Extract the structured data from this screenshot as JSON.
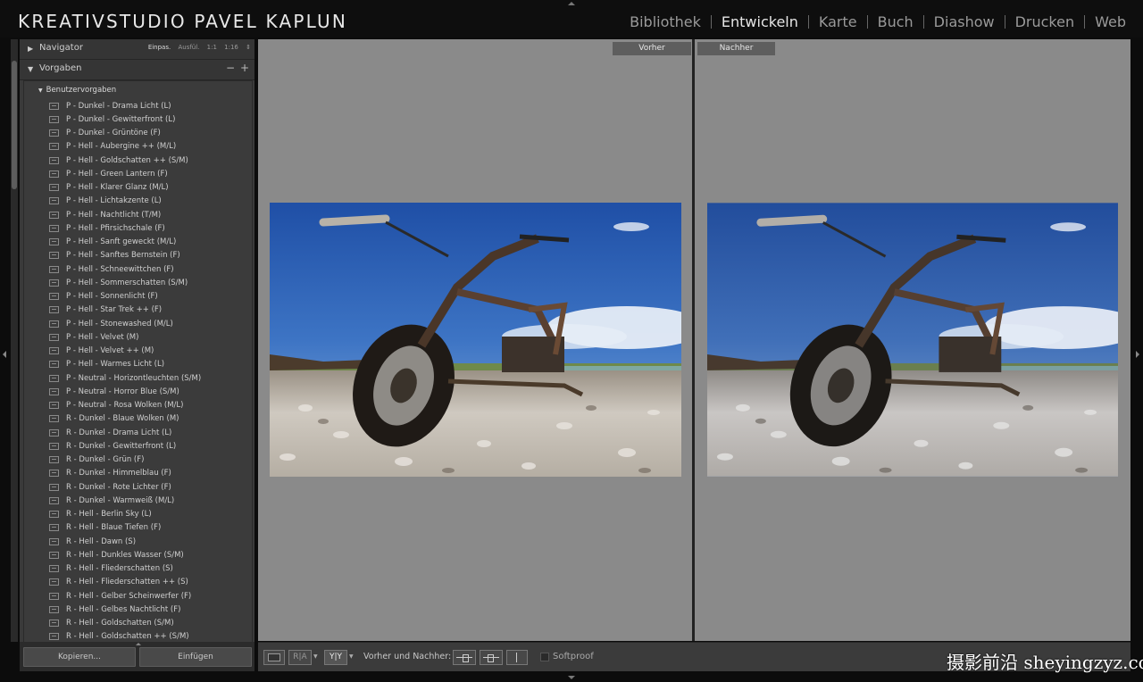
{
  "app": {
    "studio_name": "KREATIVSTUDIO PAVEL KAPLUN"
  },
  "modules": [
    {
      "label": "Bibliothek",
      "active": false
    },
    {
      "label": "Entwickeln",
      "active": true
    },
    {
      "label": "Karte",
      "active": false
    },
    {
      "label": "Buch",
      "active": false
    },
    {
      "label": "Diashow",
      "active": false
    },
    {
      "label": "Drucken",
      "active": false
    },
    {
      "label": "Web",
      "active": false
    }
  ],
  "left_panel": {
    "navigator": {
      "label": "Navigator",
      "options": [
        "Einpas.",
        "Ausfül.",
        "1:1",
        "1:16"
      ]
    },
    "presets": {
      "label": "Vorgaben",
      "minus": "−",
      "plus": "+",
      "folder": "Benutzervorgaben",
      "items": [
        "P - Dunkel - Drama Licht (L)",
        "P - Dunkel - Gewitterfront (L)",
        "P - Dunkel - Grüntöne (F)",
        "P - Hell - Aubergine ++ (M/L)",
        "P - Hell - Goldschatten ++ (S/M)",
        "P - Hell - Green Lantern (F)",
        "P - Hell - Klarer Glanz (M/L)",
        "P - Hell - Lichtakzente (L)",
        "P - Hell - Nachtlicht (T/M)",
        "P - Hell - Pfirsichschale (F)",
        "P - Hell - Sanft geweckt (M/L)",
        "P - Hell - Sanftes Bernstein (F)",
        "P - Hell - Schneewittchen (F)",
        "P - Hell - Sommerschatten (S/M)",
        "P - Hell - Sonnenlicht (F)",
        "P - Hell - Star Trek ++ (F)",
        "P - Hell - Stonewashed (M/L)",
        "P - Hell - Velvet (M)",
        "P - Hell - Velvet ++ (M)",
        "P - Hell - Warmes Licht (L)",
        "P - Neutral - Horizontleuchten (S/M)",
        "P - Neutral - Horror Blue (S/M)",
        "P - Neutral - Rosa Wolken (M/L)",
        "R - Dunkel - Blaue Wolken (M)",
        "R - Dunkel - Drama Licht (L)",
        "R - Dunkel - Gewitterfront (L)",
        "R - Dunkel - Grün (F)",
        "R - Dunkel - Himmelblau (F)",
        "R - Dunkel - Rote Lichter (F)",
        "R - Dunkel - Warmweiß (M/L)",
        "R - Hell - Berlin Sky (L)",
        "R - Hell - Blaue Tiefen (F)",
        "R - Hell - Dawn (S)",
        "R - Hell - Dunkles Wasser (S/M)",
        "R - Hell - Fliederschatten (S)",
        "R - Hell - Fliederschatten ++ (S)",
        "R - Hell - Gelber Scheinwerfer (F)",
        "R - Hell - Gelbes Nachtlicht (F)",
        "R - Hell - Goldschatten (S/M)",
        "R - Hell - Goldschatten ++ (S/M)"
      ]
    },
    "buttons": {
      "copy": "Kopieren...",
      "paste": "Einfügen"
    }
  },
  "compare": {
    "before_label": "Vorher",
    "after_label": "Nachher"
  },
  "toolbar": {
    "view_ra": "R|A",
    "view_yy": "Y|Y",
    "before_after_label": "Vorher und Nachher:",
    "softproof_label": "Softproof"
  },
  "watermark": "摄影前沿 sheyingzyz.com",
  "colors": {
    "main_bg": "#8a8a8a",
    "panel_bg": "#3a3a3a",
    "active_module": "#e6e6e6"
  }
}
